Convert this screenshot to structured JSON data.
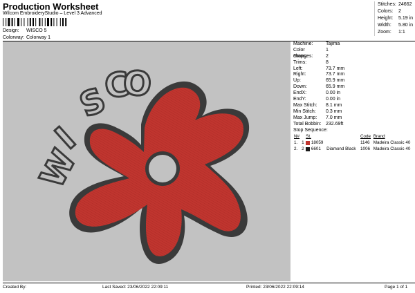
{
  "header": {
    "title": "Production Worksheet",
    "subtitle": "Wilcom EmbroideryStudio – Level 3 Advanced",
    "design_label": "Design:",
    "design_value": "WISCO 5",
    "colorway_label": "Colorway:",
    "colorway_value": "Colorway 1"
  },
  "stats": {
    "items": [
      {
        "label": "Stitches:",
        "value": "24662"
      },
      {
        "label": "Colors:",
        "value": "2"
      },
      {
        "label": "Height:",
        "value": "5.19 in"
      },
      {
        "label": "Width:",
        "value": "5.80 in"
      },
      {
        "label": "Zoom:",
        "value": "1:1"
      }
    ]
  },
  "design_preview": {
    "text": "WISCO",
    "letters": [
      "W",
      "I",
      "S",
      "C",
      "O"
    ],
    "colors": {
      "background": "#c2c2c2",
      "fill": "#c0352f",
      "outline": "#3a3a3a",
      "letters": "#3a3a3a"
    }
  },
  "info": {
    "items": [
      {
        "label": "Machine:",
        "value": "Tajima"
      },
      {
        "label": "Color changes:",
        "value": "1"
      },
      {
        "label": "Stops:",
        "value": "2"
      },
      {
        "label": "Trims:",
        "value": "8"
      },
      {
        "label": "Left:",
        "value": "73.7 mm"
      },
      {
        "label": "Right:",
        "value": "73.7 mm"
      },
      {
        "label": "Up:",
        "value": "65.9 mm"
      },
      {
        "label": "Down:",
        "value": "65.9 mm"
      },
      {
        "label": "EndX:",
        "value": "0.00 in"
      },
      {
        "label": "EndY:",
        "value": "0.00 in"
      },
      {
        "label": "Max Stitch:",
        "value": "8.1 mm"
      },
      {
        "label": "Min Stitch:",
        "value": "0.3 mm"
      },
      {
        "label": "Max Jump:",
        "value": "7.0 mm"
      },
      {
        "label": "Total Bobbin:",
        "value": "232.69ft"
      }
    ]
  },
  "stop_sequence": {
    "title": "Stop Sequence:",
    "headers": [
      "N#",
      "St.",
      "Code",
      "Brand"
    ],
    "rows": [
      {
        "num": "1.",
        "step": "1",
        "swatch": "#c0352f",
        "code": "18059",
        "name": "",
        "stitches": "1146",
        "brand": "Madeira Classic 40"
      },
      {
        "num": "2.",
        "step": "2",
        "swatch": "#1a1a1a",
        "code": "6601",
        "name": "Diamond Black",
        "stitches": "1006",
        "brand": "Madeira Classic 40"
      }
    ]
  },
  "footer": {
    "created_by": "Created By:",
    "last_saved": "Last Saved: 23/06/2022 22:09:11",
    "printed": "Printed: 23/06/2022 22:09:14",
    "page": "Page 1 of 1"
  }
}
